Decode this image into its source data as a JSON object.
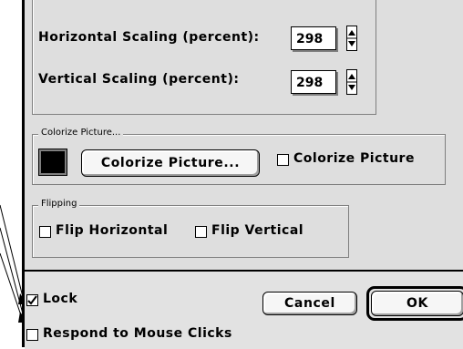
{
  "scaling": {
    "horizontal_label": "Horizontal Scaling (percent):",
    "horizontal_value": "298",
    "vertical_label": "Vertical Scaling (percent):",
    "vertical_value": "298"
  },
  "colorize": {
    "group_title": "Colorize Picture...",
    "swatch_color": "#000000",
    "button_label": "Colorize Picture...",
    "checkbox_label": "Colorize Picture",
    "checkbox_checked": false
  },
  "flipping": {
    "group_title": "Flipping",
    "flip_horizontal_label": "Flip Horizontal",
    "flip_horizontal_checked": false,
    "flip_vertical_label": "Flip Vertical",
    "flip_vertical_checked": false
  },
  "footer": {
    "lock_label": "Lock",
    "lock_checked": true,
    "respond_label": "Respond to Mouse Clicks",
    "respond_checked": false,
    "cancel_label": "Cancel",
    "ok_label": "OK"
  }
}
